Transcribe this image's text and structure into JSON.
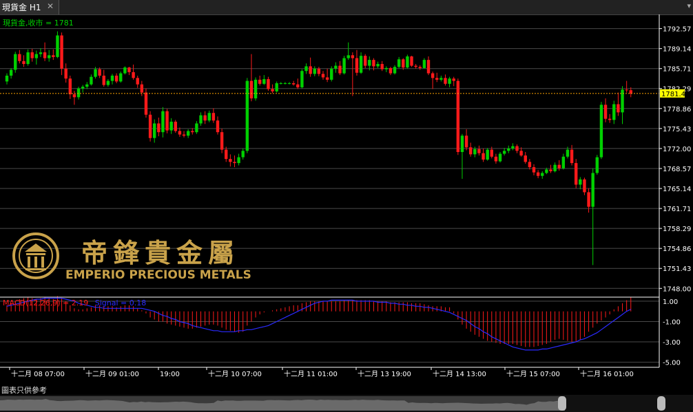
{
  "tab": {
    "label": "現貨金 H1",
    "close": "✕"
  },
  "menu_icon": "▾",
  "disclaimer": "圖表只供參考",
  "logo": {
    "chinese": "帝鋒貴金屬",
    "english": "EMPERIO PRECIOUS METALS"
  },
  "colors": {
    "up": "#00d000",
    "down": "#ff1a1a",
    "grid": "#4a4a4a",
    "price_line": "#ffa500",
    "axis_text": "#ffffff",
    "current_tag": "#ffff00",
    "macd_hist": "#ff1a1a",
    "signal": "#2a2aff",
    "gold": "#c9a24a"
  },
  "chart_data": [
    {
      "type": "candlestick",
      "label": "現貨金,收市 = 1781",
      "current_price": "1781.45",
      "ylim": [
        1746.5,
        1795
      ],
      "yticks": [
        "1792.57",
        "1789.14",
        "1785.71",
        "1782.29",
        "1778.86",
        "1775.43",
        "1772.00",
        "1768.57",
        "1765.14",
        "1761.71",
        "1758.29",
        "1754.86",
        "1751.43",
        "1748.00"
      ],
      "xticks": [
        "十二月 08 07:00",
        "十二月 09 01:00",
        "19:00",
        "十二月 10 07:00",
        "十二月 11 01:00",
        "十二月 13 19:00",
        "十二月 14 13:00",
        "十二月 15 07:00",
        "十二月 16 01:00"
      ],
      "candles": [
        [
          1783.5,
          1784.9,
          1783.0,
          1784.5
        ],
        [
          1784.5,
          1785.8,
          1784.0,
          1785.5
        ],
        [
          1785.5,
          1788.6,
          1785.0,
          1788.2
        ],
        [
          1788.2,
          1788.9,
          1786.6,
          1787.0
        ],
        [
          1787.0,
          1788.0,
          1786.0,
          1786.5
        ],
        [
          1786.5,
          1789.0,
          1786.2,
          1788.5
        ],
        [
          1788.5,
          1789.1,
          1786.9,
          1787.5
        ],
        [
          1787.5,
          1788.8,
          1786.4,
          1788.2
        ],
        [
          1788.2,
          1789.2,
          1787.7,
          1788.5
        ],
        [
          1788.5,
          1790.2,
          1787.0,
          1787.5
        ],
        [
          1787.5,
          1788.9,
          1786.9,
          1788.0
        ],
        [
          1788.0,
          1789.0,
          1787.2,
          1787.7
        ],
        [
          1787.7,
          1792.1,
          1787.5,
          1791.4
        ],
        [
          1791.4,
          1791.9,
          1784.6,
          1785.7
        ],
        [
          1785.7,
          1786.6,
          1783.3,
          1784.0
        ],
        [
          1784.0,
          1784.5,
          1780.5,
          1781.3
        ],
        [
          1781.3,
          1781.9,
          1779.5,
          1780.8
        ],
        [
          1780.8,
          1782.6,
          1780.4,
          1782.3
        ],
        [
          1782.3,
          1782.9,
          1781.6,
          1782.6
        ],
        [
          1782.6,
          1783.4,
          1782.2,
          1783.0
        ],
        [
          1783.0,
          1784.7,
          1782.8,
          1784.3
        ],
        [
          1784.3,
          1786.0,
          1784.0,
          1785.6
        ],
        [
          1785.6,
          1785.9,
          1784.1,
          1784.5
        ],
        [
          1784.5,
          1785.5,
          1782.6,
          1782.9
        ],
        [
          1782.9,
          1783.9,
          1782.6,
          1783.6
        ],
        [
          1783.6,
          1784.8,
          1783.0,
          1784.5
        ],
        [
          1784.5,
          1784.9,
          1783.2,
          1783.5
        ],
        [
          1783.5,
          1785.2,
          1783.3,
          1784.9
        ],
        [
          1784.9,
          1786.1,
          1784.7,
          1785.9
        ],
        [
          1785.9,
          1786.0,
          1784.6,
          1785.1
        ],
        [
          1785.1,
          1786.4,
          1783.8,
          1784.1
        ],
        [
          1784.1,
          1784.5,
          1782.4,
          1783.0
        ],
        [
          1783.0,
          1783.6,
          1781.0,
          1781.6
        ],
        [
          1781.6,
          1782.3,
          1777.3,
          1777.8
        ],
        [
          1777.8,
          1778.4,
          1773.2,
          1773.8
        ],
        [
          1773.8,
          1777.0,
          1773.0,
          1776.3
        ],
        [
          1776.3,
          1777.3,
          1774.1,
          1774.8
        ],
        [
          1774.8,
          1779.1,
          1773.9,
          1778.4
        ],
        [
          1778.4,
          1778.8,
          1774.6,
          1775.1
        ],
        [
          1775.1,
          1777.2,
          1774.5,
          1776.6
        ],
        [
          1776.6,
          1776.9,
          1774.7,
          1775.0
        ],
        [
          1775.0,
          1775.6,
          1774.0,
          1774.4
        ],
        [
          1774.4,
          1775.0,
          1773.9,
          1774.2
        ],
        [
          1774.2,
          1775.3,
          1773.8,
          1775.0
        ],
        [
          1775.0,
          1775.5,
          1774.4,
          1774.8
        ],
        [
          1774.8,
          1776.7,
          1774.5,
          1776.3
        ],
        [
          1776.3,
          1778.2,
          1775.9,
          1777.7
        ],
        [
          1777.7,
          1778.4,
          1776.2,
          1776.8
        ],
        [
          1776.8,
          1778.5,
          1776.5,
          1778.1
        ],
        [
          1778.1,
          1778.9,
          1776.4,
          1776.8
        ],
        [
          1776.8,
          1777.5,
          1774.4,
          1774.8
        ],
        [
          1774.8,
          1775.4,
          1771.2,
          1771.8
        ],
        [
          1771.8,
          1772.3,
          1769.7,
          1770.2
        ],
        [
          1770.2,
          1771.0,
          1768.9,
          1769.7
        ],
        [
          1769.7,
          1770.8,
          1768.8,
          1769.5
        ],
        [
          1769.5,
          1771.1,
          1769.1,
          1770.5
        ],
        [
          1770.5,
          1772.0,
          1770.1,
          1771.6
        ],
        [
          1771.6,
          1784.1,
          1771.2,
          1783.6
        ],
        [
          1783.6,
          1788.2,
          1780.1,
          1780.6
        ],
        [
          1780.6,
          1784.2,
          1780.2,
          1783.8
        ],
        [
          1783.8,
          1784.5,
          1782.8,
          1783.1
        ],
        [
          1783.1,
          1784.6,
          1782.9,
          1783.9
        ],
        [
          1783.9,
          1784.3,
          1781.9,
          1782.2
        ],
        [
          1782.2,
          1783.0,
          1781.5,
          1781.8
        ],
        [
          1781.8,
          1783.5,
          1781.6,
          1783.2
        ],
        [
          1783.2,
          1783.4,
          1783.0,
          1783.2
        ],
        [
          1783.2,
          1783.4,
          1783.0,
          1783.2
        ],
        [
          1783.2,
          1783.4,
          1783.0,
          1783.2
        ],
        [
          1783.2,
          1783.6,
          1782.8,
          1783.0
        ],
        [
          1783.0,
          1784.0,
          1782.2,
          1782.5
        ],
        [
          1782.5,
          1785.6,
          1782.3,
          1785.3
        ],
        [
          1785.3,
          1786.6,
          1784.8,
          1786.1
        ],
        [
          1786.1,
          1787.6,
          1784.3,
          1784.8
        ],
        [
          1784.8,
          1786.1,
          1784.4,
          1785.7
        ],
        [
          1785.7,
          1786.0,
          1784.4,
          1784.8
        ],
        [
          1784.8,
          1785.3,
          1783.8,
          1784.2
        ],
        [
          1784.2,
          1785.7,
          1783.4,
          1783.8
        ],
        [
          1783.8,
          1786.1,
          1783.5,
          1785.7
        ],
        [
          1785.7,
          1786.8,
          1785.0,
          1786.2
        ],
        [
          1786.2,
          1787.0,
          1784.6,
          1784.9
        ],
        [
          1784.9,
          1787.9,
          1784.7,
          1787.5
        ],
        [
          1787.5,
          1790.2,
          1787.2,
          1788.0
        ],
        [
          1788.0,
          1788.5,
          1781.0,
          1787.5
        ],
        [
          1787.5,
          1788.9,
          1784.5,
          1785.0
        ],
        [
          1785.0,
          1788.5,
          1784.8,
          1787.9
        ],
        [
          1787.9,
          1788.2,
          1785.8,
          1786.2
        ],
        [
          1786.2,
          1787.8,
          1785.4,
          1787.2
        ],
        [
          1787.2,
          1787.5,
          1785.4,
          1786.1
        ],
        [
          1786.1,
          1786.9,
          1785.8,
          1786.5
        ],
        [
          1786.5,
          1787.0,
          1785.3,
          1785.6
        ],
        [
          1785.6,
          1786.1,
          1785.1,
          1785.8
        ],
        [
          1785.8,
          1786.0,
          1784.6,
          1784.9
        ],
        [
          1784.9,
          1786.3,
          1784.7,
          1786.0
        ],
        [
          1786.0,
          1787.7,
          1785.8,
          1787.3
        ],
        [
          1787.3,
          1787.5,
          1785.5,
          1785.9
        ],
        [
          1785.9,
          1788.1,
          1785.7,
          1787.8
        ],
        [
          1787.8,
          1787.9,
          1786.0,
          1786.2
        ],
        [
          1786.2,
          1786.5,
          1785.7,
          1786.0
        ],
        [
          1786.0,
          1786.3,
          1785.5,
          1785.8
        ],
        [
          1785.8,
          1787.5,
          1785.7,
          1787.2
        ],
        [
          1787.2,
          1787.8,
          1784.6,
          1784.9
        ],
        [
          1784.9,
          1785.2,
          1782.2,
          1784.1
        ],
        [
          1784.1,
          1785.0,
          1783.4,
          1783.8
        ],
        [
          1783.8,
          1784.5,
          1783.5,
          1784.1
        ],
        [
          1784.1,
          1784.7,
          1782.8,
          1783.1
        ],
        [
          1783.1,
          1784.3,
          1782.5,
          1784.0
        ],
        [
          1784.0,
          1784.3,
          1782.7,
          1783.6
        ],
        [
          1783.6,
          1784.0,
          1770.9,
          1771.4
        ],
        [
          1771.4,
          1774.5,
          1766.8,
          1774.2
        ],
        [
          1774.2,
          1775.3,
          1771.7,
          1772.2
        ],
        [
          1772.2,
          1773.0,
          1770.6,
          1771.0
        ],
        [
          1771.0,
          1772.3,
          1770.5,
          1771.9
        ],
        [
          1771.9,
          1772.5,
          1770.8,
          1771.2
        ],
        [
          1771.2,
          1772.0,
          1769.7,
          1770.1
        ],
        [
          1770.1,
          1772.1,
          1769.9,
          1771.8
        ],
        [
          1771.8,
          1772.3,
          1770.3,
          1770.6
        ],
        [
          1770.6,
          1771.1,
          1769.4,
          1769.8
        ],
        [
          1769.8,
          1771.4,
          1769.6,
          1771.1
        ],
        [
          1771.1,
          1772.1,
          1770.8,
          1771.6
        ],
        [
          1771.6,
          1772.5,
          1771.2,
          1772.0
        ],
        [
          1772.0,
          1772.9,
          1771.7,
          1772.4
        ],
        [
          1772.4,
          1772.7,
          1771.2,
          1771.6
        ],
        [
          1771.6,
          1772.2,
          1770.6,
          1770.8
        ],
        [
          1770.8,
          1771.4,
          1769.4,
          1769.7
        ],
        [
          1769.7,
          1770.2,
          1768.4,
          1768.8
        ],
        [
          1768.8,
          1769.3,
          1767.4,
          1767.9
        ],
        [
          1767.9,
          1768.3,
          1766.9,
          1767.3
        ],
        [
          1767.3,
          1768.1,
          1766.8,
          1767.8
        ],
        [
          1767.8,
          1768.7,
          1767.6,
          1768.4
        ],
        [
          1768.4,
          1769.2,
          1767.8,
          1768.1
        ],
        [
          1768.1,
          1769.6,
          1767.9,
          1769.2
        ],
        [
          1769.2,
          1770.0,
          1768.2,
          1768.6
        ],
        [
          1768.6,
          1771.1,
          1768.4,
          1770.6
        ],
        [
          1770.6,
          1772.3,
          1770.3,
          1771.8
        ],
        [
          1771.8,
          1772.6,
          1769.1,
          1769.5
        ],
        [
          1769.5,
          1770.2,
          1765.2,
          1765.8
        ],
        [
          1765.8,
          1767.1,
          1765.0,
          1766.7
        ],
        [
          1766.7,
          1767.0,
          1764.0,
          1764.5
        ],
        [
          1764.5,
          1765.2,
          1761.0,
          1762.0
        ],
        [
          1762.0,
          1768.6,
          1752.0,
          1767.8
        ],
        [
          1767.8,
          1770.9,
          1767.5,
          1770.5
        ],
        [
          1770.5,
          1780.0,
          1770.2,
          1779.5
        ],
        [
          1779.5,
          1780.6,
          1776.5,
          1777.1
        ],
        [
          1777.1,
          1777.9,
          1776.4,
          1776.9
        ],
        [
          1776.9,
          1780.2,
          1776.2,
          1779.6
        ],
        [
          1779.6,
          1781.6,
          1777.6,
          1778.2
        ],
        [
          1778.2,
          1782.7,
          1776.2,
          1782.1
        ],
        [
          1782.1,
          1783.6,
          1781.6,
          1782.0
        ],
        [
          1782.0,
          1782.5,
          1780.8,
          1781.4
        ]
      ]
    },
    {
      "type": "bar",
      "label": "MACD(12,26,9) = 2.19",
      "signal_label": "Signal = 0.18",
      "ylim": [
        -5.5,
        1.4
      ],
      "yticks": [
        "1.00",
        "-1.00",
        "-3.00",
        "-5.00"
      ],
      "macd": [
        0.6,
        0.8,
        1.0,
        1.2,
        1.3,
        1.4,
        1.3,
        1.2,
        1.3,
        1.4,
        1.3,
        1.2,
        1.5,
        1.3,
        1.0,
        0.6,
        0.3,
        0.2,
        0.2,
        0.3,
        0.4,
        0.6,
        0.6,
        0.5,
        0.5,
        0.5,
        0.4,
        0.5,
        0.6,
        0.6,
        0.5,
        0.3,
        0.1,
        -0.2,
        -0.6,
        -0.8,
        -1.0,
        -1.0,
        -1.2,
        -1.3,
        -1.4,
        -1.5,
        -1.6,
        -1.7,
        -1.7,
        -1.6,
        -1.5,
        -1.4,
        -1.3,
        -1.3,
        -1.4,
        -1.6,
        -1.8,
        -1.9,
        -2.0,
        -2.1,
        -2.0,
        -1.4,
        -1.0,
        -0.6,
        -0.3,
        -0.1,
        0.0,
        0.1,
        0.2,
        0.3,
        0.4,
        0.5,
        0.6,
        0.6,
        0.8,
        0.9,
        1.0,
        1.0,
        1.0,
        1.0,
        1.0,
        1.0,
        1.0,
        1.0,
        1.1,
        1.1,
        1.1,
        1.1,
        1.1,
        1.1,
        1.1,
        1.0,
        1.0,
        1.0,
        1.0,
        0.9,
        0.9,
        0.9,
        0.9,
        0.9,
        0.8,
        0.8,
        0.8,
        0.7,
        0.6,
        0.5,
        0.5,
        0.5,
        0.4,
        0.4,
        -0.2,
        -0.8,
        -1.3,
        -1.7,
        -2.0,
        -2.3,
        -2.5,
        -2.7,
        -2.9,
        -3.0,
        -3.1,
        -3.2,
        -3.2,
        -3.2,
        -3.2,
        -3.3,
        -3.4,
        -3.5,
        -3.5,
        -3.5,
        -3.4,
        -3.3,
        -3.2,
        -3.0,
        -2.8,
        -2.7,
        -2.8,
        -2.9,
        -3.0,
        -3.0,
        -2.8,
        -2.5,
        -2.0,
        -1.6,
        -1.2,
        -0.9,
        -0.6,
        -0.3,
        0.2,
        0.5,
        0.8,
        1.1,
        1.4
      ],
      "signal": [
        0.5,
        0.6,
        0.7,
        0.8,
        0.9,
        1.0,
        1.1,
        1.2,
        1.2,
        1.3,
        1.3,
        1.3,
        1.3,
        1.3,
        1.2,
        1.1,
        1.0,
        0.8,
        0.7,
        0.6,
        0.5,
        0.4,
        0.4,
        0.3,
        0.3,
        0.3,
        0.3,
        0.3,
        0.3,
        0.3,
        0.3,
        0.3,
        0.3,
        0.2,
        0.1,
        0.0,
        -0.2,
        -0.4,
        -0.5,
        -0.7,
        -0.8,
        -1.0,
        -1.1,
        -1.2,
        -1.4,
        -1.5,
        -1.6,
        -1.7,
        -1.8,
        -1.9,
        -1.9,
        -2.0,
        -2.0,
        -2.0,
        -2.0,
        -1.9,
        -1.9,
        -1.8,
        -1.8,
        -1.7,
        -1.6,
        -1.5,
        -1.4,
        -1.2,
        -1.0,
        -0.8,
        -0.6,
        -0.4,
        -0.2,
        0.0,
        0.2,
        0.4,
        0.6,
        0.8,
        0.9,
        1.0,
        1.0,
        1.1,
        1.1,
        1.1,
        1.1,
        1.1,
        1.1,
        1.0,
        1.0,
        1.0,
        1.0,
        1.0,
        0.9,
        0.9,
        0.9,
        0.8,
        0.8,
        0.7,
        0.7,
        0.6,
        0.6,
        0.5,
        0.5,
        0.4,
        0.4,
        0.3,
        0.2,
        0.1,
        0.0,
        -0.1,
        -0.3,
        -0.5,
        -0.7,
        -0.9,
        -1.2,
        -1.5,
        -1.7,
        -2.0,
        -2.2,
        -2.5,
        -2.7,
        -2.9,
        -3.1,
        -3.3,
        -3.5,
        -3.6,
        -3.7,
        -3.8,
        -3.8,
        -3.8,
        -3.8,
        -3.7,
        -3.7,
        -3.6,
        -3.5,
        -3.4,
        -3.3,
        -3.2,
        -3.1,
        -3.0,
        -2.8,
        -2.7,
        -2.5,
        -2.3,
        -2.1,
        -1.8,
        -1.5,
        -1.2,
        -0.9,
        -0.6,
        -0.3,
        0.0,
        0.2
      ]
    }
  ]
}
